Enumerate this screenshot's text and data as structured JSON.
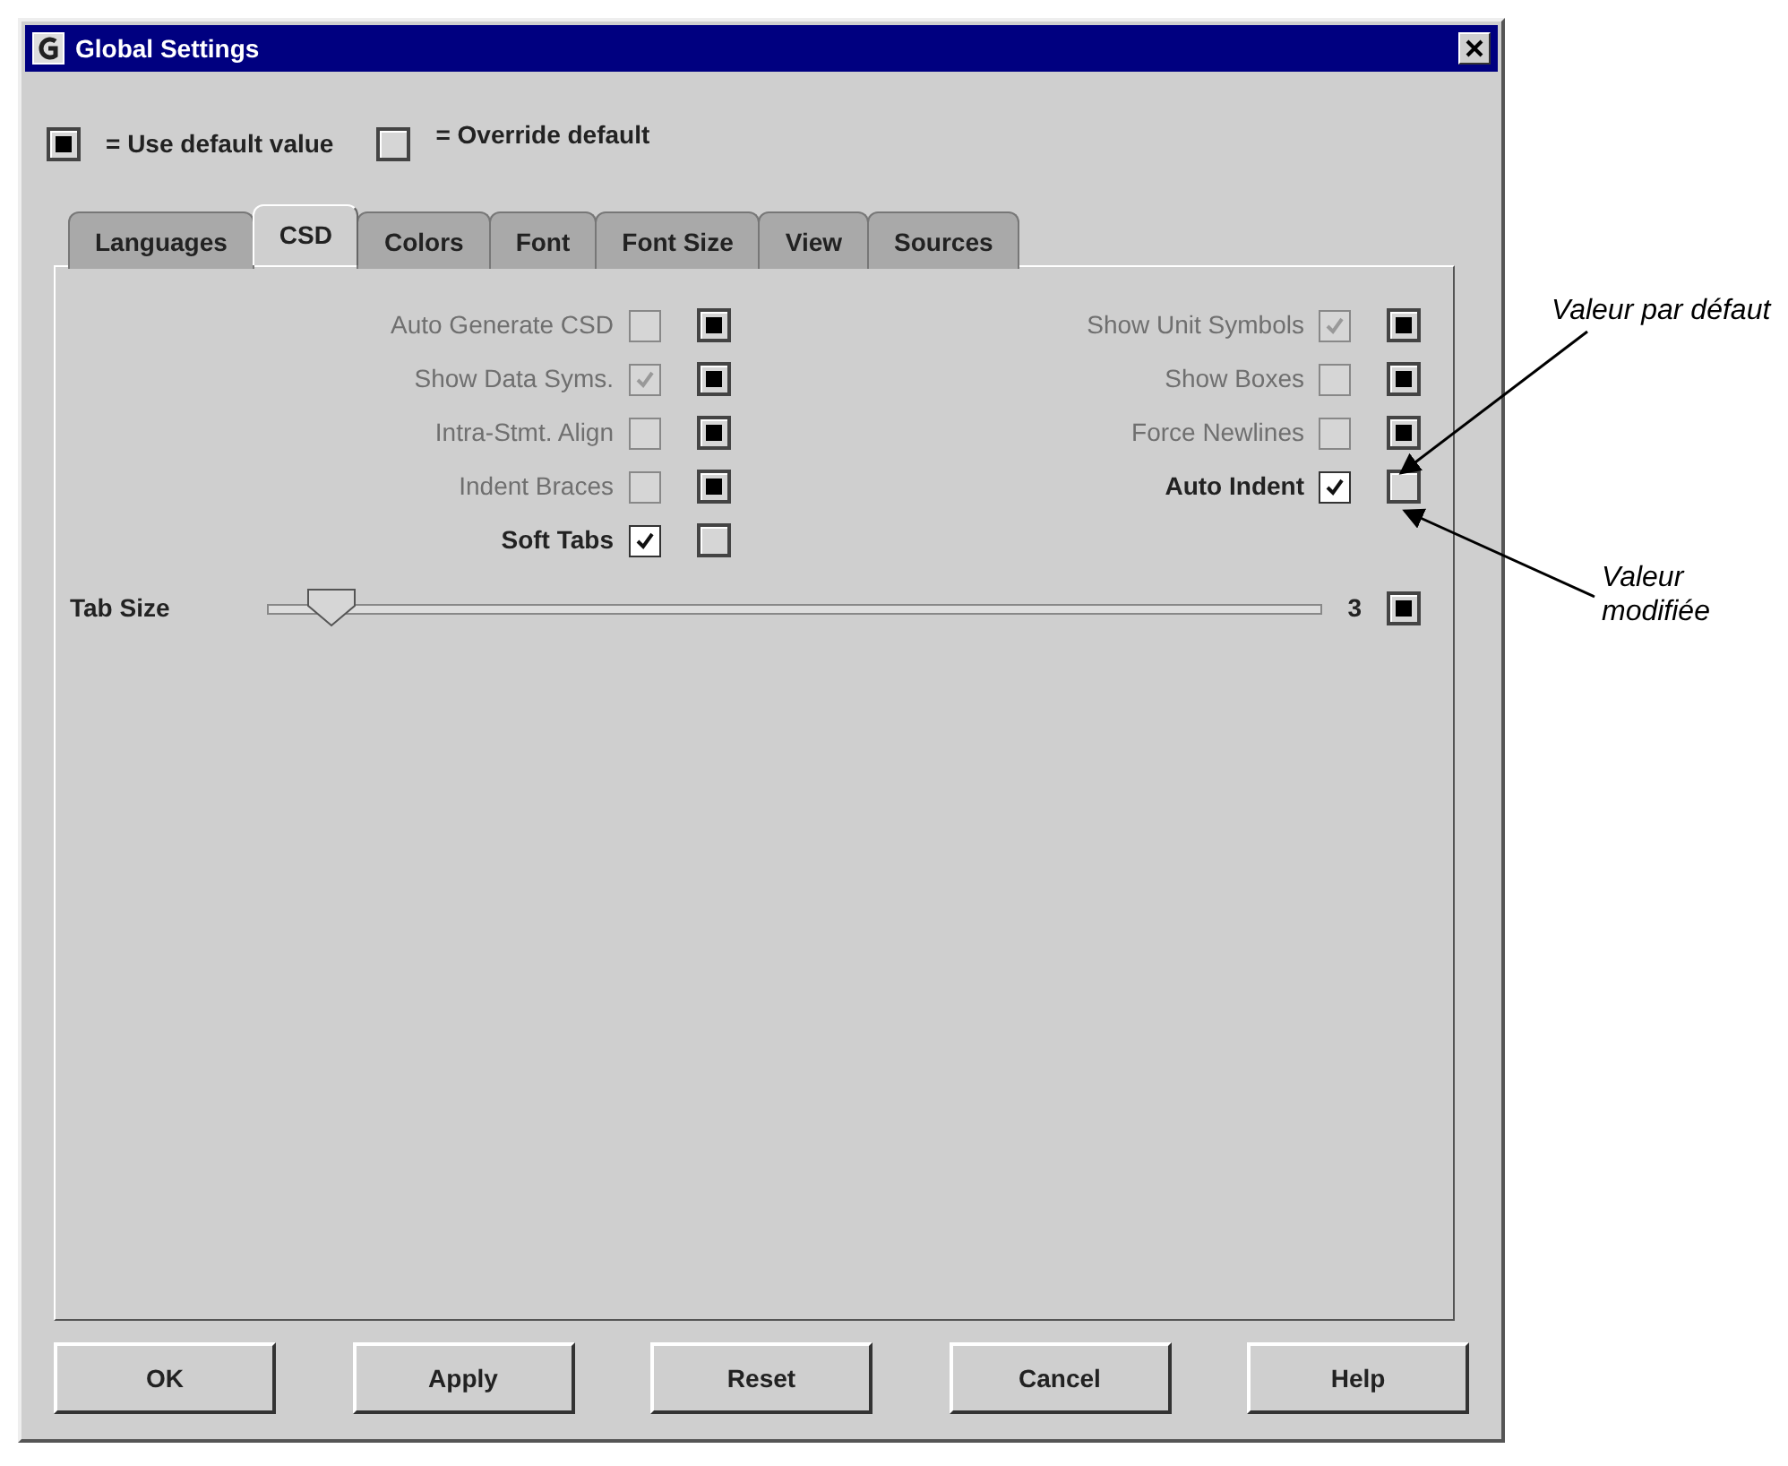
{
  "window": {
    "title": "Global Settings"
  },
  "legend": [
    {
      "text": "= Use default value"
    },
    {
      "text": "= Override default"
    }
  ],
  "tabs": [
    {
      "label": "Languages",
      "selected": false
    },
    {
      "label": "CSD",
      "selected": true
    },
    {
      "label": "Colors",
      "selected": false
    },
    {
      "label": "Font",
      "selected": false
    },
    {
      "label": "Font Size",
      "selected": false
    },
    {
      "label": "View",
      "selected": false
    },
    {
      "label": "Sources",
      "selected": false
    }
  ],
  "options_left": [
    {
      "label": "Auto Generate CSD",
      "checked": false,
      "use_default": true
    },
    {
      "label": "Show Data Syms.",
      "checked": true,
      "use_default": true
    },
    {
      "label": "Intra-Stmt. Align",
      "checked": false,
      "use_default": true
    },
    {
      "label": "Indent Braces",
      "checked": false,
      "use_default": true
    },
    {
      "label": "Soft Tabs",
      "checked": true,
      "use_default": false
    }
  ],
  "options_right": [
    {
      "label": "Show Unit Symbols",
      "checked": true,
      "use_default": true
    },
    {
      "label": "Show Boxes",
      "checked": false,
      "use_default": true
    },
    {
      "label": "Force Newlines",
      "checked": false,
      "use_default": true
    },
    {
      "label": "Auto Indent",
      "checked": true,
      "use_default": false
    }
  ],
  "tab_size": {
    "label": "Tab Size",
    "level": 0.06,
    "reading": "3",
    "use_default": true
  },
  "buttons": [
    "OK",
    "Apply",
    "Reset",
    "Cancel",
    "Help"
  ],
  "annotations": [
    {
      "text": "Valeur par défaut"
    },
    {
      "text": "Valeur modifiée"
    }
  ]
}
